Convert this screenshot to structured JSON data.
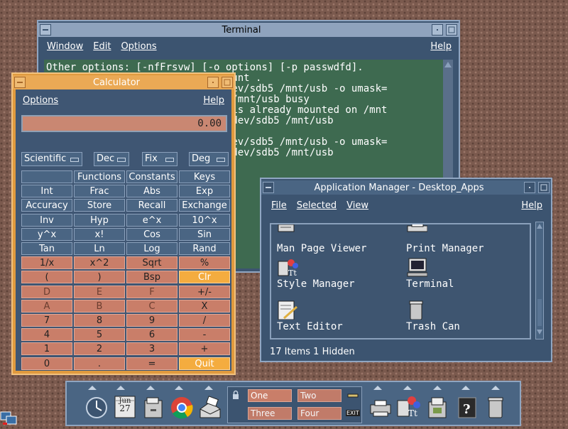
{
  "terminal": {
    "title": "Terminal",
    "menu": [
      "Window",
      "Edit",
      "Options"
    ],
    "help": "Help",
    "lines": [
      "Other options: [-nfFrsvw] [-o options] [-p passwdfd].",
      "                         n 8 mount .",
      "                         unt /dev/sdb5 /mnt/usb -o umask=",
      "                         ed or /mnt/usb busy",
      "                         /sdb5 is already mounted on /mnt",
      "                         ount /dev/sdb5 /mnt/usb",
      "",
      "                         unt /dev/sdb5 /mnt/usb -o umask=",
      "                         ount /dev/sdb5 /mnt/usb"
    ]
  },
  "calculator": {
    "title": "Calculator",
    "menu_options": "Options",
    "help": "Help",
    "display": "0.00",
    "modes": [
      "Scientific",
      "Dec",
      "Fix",
      "Deg"
    ],
    "rows": [
      [
        "",
        "Functions",
        "Constants",
        "Keys"
      ],
      [
        "Int",
        "Frac",
        "Abs",
        "Exp"
      ],
      [
        "Accuracy",
        "Store",
        "Recall",
        "Exchange"
      ],
      [
        "Inv",
        "Hyp",
        "e^x",
        "10^x"
      ],
      [
        "y^x",
        "x!",
        "Cos",
        "Sin"
      ],
      [
        "Tan",
        "Ln",
        "Log",
        "Rand"
      ],
      [
        "1/x",
        "x^2",
        "Sqrt",
        "%"
      ],
      [
        "(",
        ")",
        "Bsp",
        "Clr"
      ],
      [
        "D",
        "E",
        "F",
        "+/-"
      ],
      [
        "A",
        "B",
        "C",
        "X"
      ],
      [
        "7",
        "8",
        "9",
        "/"
      ],
      [
        "4",
        "5",
        "6",
        "-"
      ],
      [
        "1",
        "2",
        "3",
        "+"
      ],
      [
        "0",
        ".",
        "=",
        "Quit"
      ]
    ]
  },
  "appmgr": {
    "title": "Application Manager - Desktop_Apps",
    "menu": [
      "File",
      "Selected",
      "View"
    ],
    "help": "Help",
    "items": [
      "Man Page Viewer",
      "Print Manager",
      "Style Manager",
      "Terminal",
      "Text Editor",
      "Trash Can"
    ],
    "status": "17 Items 1 Hidden"
  },
  "panel": {
    "calendar_month": "Jun",
    "calendar_day": "27",
    "workspaces": [
      "One",
      "Two",
      "Three",
      "Four"
    ],
    "exit_label": "EXIT"
  }
}
